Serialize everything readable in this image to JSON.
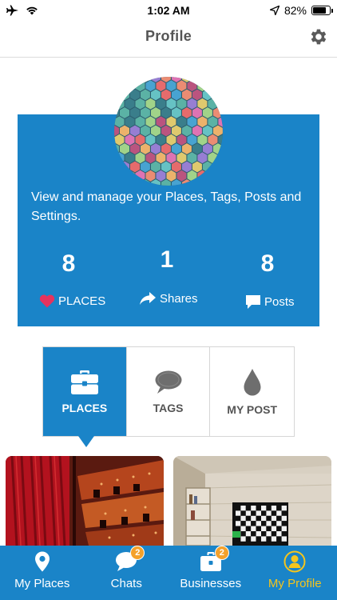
{
  "status_bar": {
    "time": "1:02 AM",
    "battery": "82%",
    "battery_level": 0.82
  },
  "header": {
    "title": "Profile",
    "settings_icon": "gear-icon"
  },
  "profile": {
    "description": "View and manage your Places, Tags, Posts and Settings.",
    "stats": [
      {
        "value": "8",
        "label": "PLACES",
        "icon": "heart-icon"
      },
      {
        "value": "1",
        "label": "Shares",
        "icon": "share-arrow-icon"
      },
      {
        "value": "8",
        "label": "Posts",
        "icon": "comment-icon"
      }
    ]
  },
  "tabs": [
    {
      "label": "PLACES",
      "icon": "briefcase-icon",
      "active": true
    },
    {
      "label": "TAGS",
      "icon": "speech-bubble-icon",
      "active": false
    },
    {
      "label": "MY POST",
      "icon": "drop-icon",
      "active": false
    }
  ],
  "tab_bar": [
    {
      "label": "My Places",
      "icon": "map-pin-icon",
      "badge": ""
    },
    {
      "label": "Chats",
      "icon": "chat-icon",
      "badge": "2"
    },
    {
      "label": "Businesses",
      "icon": "briefcase-icon",
      "badge": "2"
    },
    {
      "label": "My Profile",
      "icon": "person-icon",
      "badge": "",
      "active": true
    }
  ],
  "colors": {
    "primary": "#1a84c8",
    "active_tab": "#f5c51c",
    "badge": "#f4a12b",
    "heart": "#e6335e"
  }
}
